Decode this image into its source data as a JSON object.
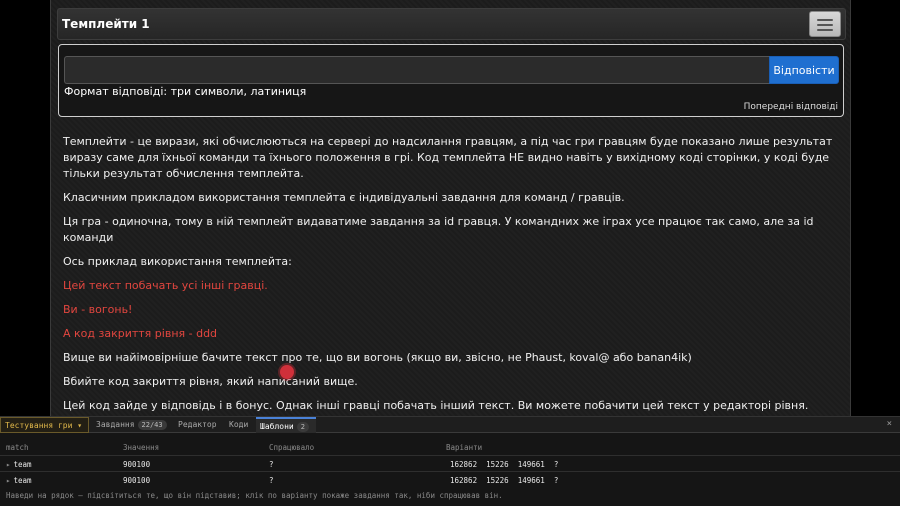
{
  "header": {
    "title": "Темплейти 1",
    "menu_icon": "hamburger-icon"
  },
  "answer": {
    "placeholder": "",
    "button_label": "Відповісти",
    "format": "Формат відповіді: три символи, латиниця",
    "prev_answers": "Попередні відповіді"
  },
  "content": {
    "paragraphs": [
      {
        "text": "Темплейти - це вирази, які обчислюються на сервері до надсилання гравцям, а під час гри гравцям буде показано лише результат виразу саме для їхньої команди та їхнього положення в грі. Код темплейта НЕ видно навіть у вихідному коді сторінки, у коді буде тільки результат обчислення темплейта."
      },
      {
        "text": "Класичним прикладом використання темплейта є індивідуальні завдання для команд / гравців."
      },
      {
        "text": "Ця гра - одиночна, тому в ній темплейт видаватиме завдання за id гравця. У командних же іграх усе працює так само, але за id команди"
      },
      {
        "text": "Ось приклад використання темплейта:"
      },
      {
        "text": "Цей текст побачать усі інші гравці."
      },
      {
        "text": "Ви - вогонь!"
      },
      {
        "text": "А код закриття рівня - ddd"
      },
      {
        "text": "Вище ви найімовірніше бачите текст про те, що ви вогонь (якщо ви, звісно, не Phaust, koval@ або banan4ik)"
      },
      {
        "text": "Вбийте код закриття рівня, який написаний вище."
      },
      {
        "text": "Цей код зайде у відповідь і в бонус. Однак інші гравці побачать інший текст. Ви можете побачити цей текст у редакторі рівня. Спробуйте вбити й інші коди в рівень."
      }
    ],
    "red_color": "#e2463f"
  },
  "devtools": {
    "tabs": {
      "game": "Тестування гри ▾",
      "tasks": "Завдання",
      "tasks_badge": "22/43",
      "editor": "Редактор",
      "codes": "Коди",
      "templates": "Шаблони",
      "templates_badge": "2"
    },
    "close": "×",
    "columns": {
      "match": "match",
      "value": "Значення",
      "fired": "Спрацювало",
      "variants": "Варіанти"
    },
    "rows": [
      {
        "match": "team",
        "value": "900100",
        "fired": "?",
        "variants": "162862  15226  149661  ?"
      },
      {
        "match": "team",
        "value": "900100",
        "fired": "?",
        "variants": "162862  15226  149661  ?"
      }
    ],
    "hint": "Наведи на рядок — підсвітиться те, що він підставив; клік по варіанту покаже завдання так, ніби спрацював він."
  },
  "colors": {
    "accent": "#1f6fd0",
    "background": "#1c1c1c",
    "game_tab": "#e0b84a"
  }
}
